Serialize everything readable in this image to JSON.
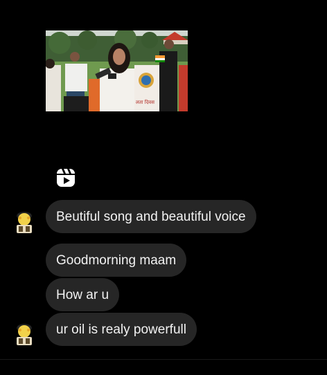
{
  "reel_post": {
    "thumbnail_alt": "shared reel thumbnail",
    "banner_text": "लता दिवस"
  },
  "messages": [
    {
      "text": "Beutiful song and beautiful voice"
    },
    {
      "text": "Goodmorning maam"
    },
    {
      "text": "How ar u"
    },
    {
      "text": "ur oil is realy powerfull"
    }
  ],
  "icons": {
    "reel": "reels-icon",
    "avatar": "sender-avatar"
  },
  "colors": {
    "background": "#000000",
    "bubble": "#262626",
    "text": "#f2f2f2"
  }
}
